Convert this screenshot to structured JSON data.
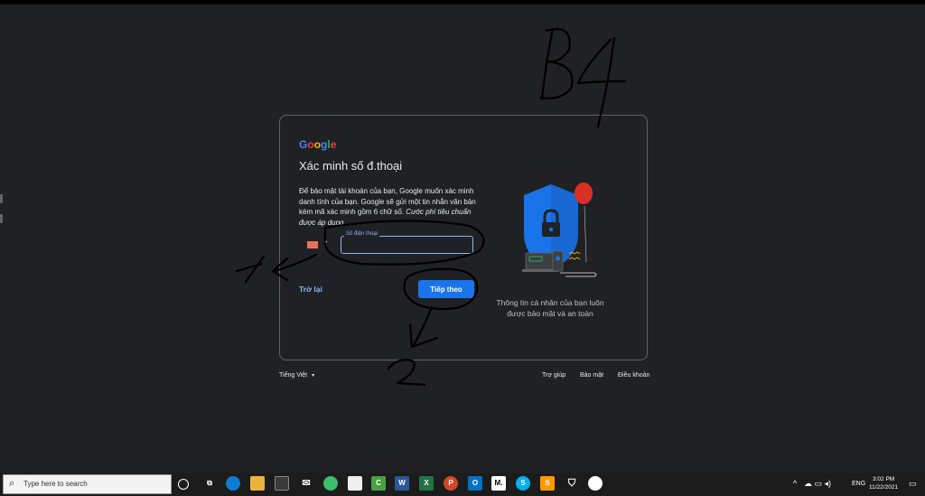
{
  "card": {
    "logo": [
      "G",
      "o",
      "o",
      "g",
      "l",
      "e"
    ],
    "title": "Xác minh số đ.thoại",
    "desc_main": "Để bảo mật tài khoản của bạn, Google muốn xác minh danh tính của bạn. Google sẽ gửi một tin nhắn văn bản kèm mã xác minh gồm 6 chữ số. ",
    "desc_italic": "Cước phí tiêu chuẩn được áp dụng",
    "phone_label": "Số điện thoại",
    "phone_value": "",
    "back_label": "Trở lại",
    "next_label": "Tiếp theo",
    "caption": "Thông tin cá nhân của bạn luôn được bảo mật và an toàn"
  },
  "footer": {
    "language": "Tiếng Việt",
    "links": [
      "Trợ giúp",
      "Bảo mật",
      "Điều khoản"
    ]
  },
  "annotations": {
    "heading": "B4",
    "step1": "1",
    "step2": "2"
  },
  "taskbar": {
    "search_placeholder": "Type here to search",
    "apps": [
      {
        "icon": "cortana-icon",
        "label": "O"
      },
      {
        "icon": "task-view-icon",
        "label": ""
      },
      {
        "icon": "edge-icon",
        "label": ""
      },
      {
        "icon": "file-explorer-icon",
        "label": ""
      },
      {
        "icon": "store-icon",
        "label": ""
      },
      {
        "icon": "mail-icon",
        "label": ""
      },
      {
        "icon": "browser-icon",
        "label": ""
      },
      {
        "icon": "app-icon",
        "label": ""
      },
      {
        "icon": "camtasia-icon",
        "label": "C"
      },
      {
        "icon": "word-icon",
        "label": "W"
      },
      {
        "icon": "excel-icon",
        "label": "X"
      },
      {
        "icon": "powerpoint-icon",
        "label": "P"
      },
      {
        "icon": "outlook-icon",
        "label": "O"
      },
      {
        "icon": "m-app-icon",
        "label": "M."
      },
      {
        "icon": "skype-icon",
        "label": "S"
      },
      {
        "icon": "sublime-icon",
        "label": "S"
      },
      {
        "icon": "security-icon",
        "label": ""
      },
      {
        "icon": "photos-icon",
        "label": ""
      }
    ],
    "tray": {
      "lang": "ENG",
      "time": "3:02 PM",
      "date": "11/22/2021"
    }
  },
  "colors": {
    "accent": "#1a73e8",
    "link": "#8ab4f8",
    "background": "#202124"
  }
}
